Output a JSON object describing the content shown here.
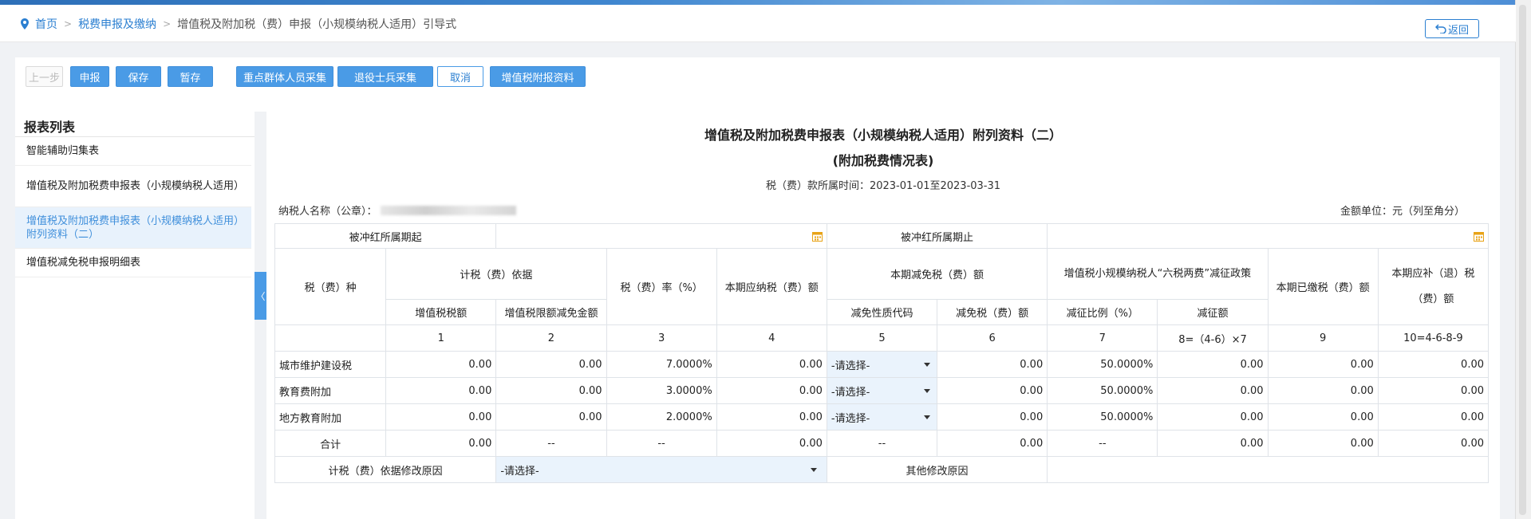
{
  "breadcrumb": {
    "home": "首页",
    "level1": "税费申报及缴纳",
    "current": "增值税及附加税（费）申报（小规模纳税人适用）引导式"
  },
  "back_label": "返回",
  "toolbar": {
    "prev": "上一步",
    "declare": "申报",
    "save": "保存",
    "temp_save": "暂存",
    "key_group": "重点群体人员采集",
    "veteran": "退役士兵采集",
    "cancel": "取消",
    "vat_attach": "增值税附报资料"
  },
  "sidebar": {
    "title": "报表列表",
    "items": [
      {
        "label": "智能辅助归集表"
      },
      {
        "label": "增值税及附加税费申报表（小规模纳税人适用）"
      },
      {
        "label": "增值税及附加税费申报表（小规模纳税人适用）附列资料（二）"
      },
      {
        "label": "增值税减免税申报明细表"
      }
    ],
    "collapse_glyph": "〈"
  },
  "form": {
    "title1": "增值税及附加税费申报表（小规模纳税人适用）附列资料（二）",
    "title2": "(附加税费情况表)",
    "period": "税（费）款所属时间：2023-01-01至2023-03-31",
    "taxpayer_label": "纳税人名称（公章）：",
    "unit": "金额单位：元（列至角分）",
    "offset_start_label": "被冲红所属期起",
    "offset_end_label": "被冲红所属期止",
    "headers": {
      "tax_type": "税（费）种",
      "basis": "计税（费）依据",
      "rate": "税（费）率（%）",
      "payable": "本期应纳税（费）额",
      "relief": "本期减免税（费）额",
      "six_tax": "增值税小规模纳税人“六税两费”减征政策",
      "paid": "本期已缴税（费）额",
      "refund": "本期应补（退）税（费）额",
      "vat_amount": "增值税税额",
      "vat_limit": "增值税限额减免金额",
      "relief_code": "减免性质代码",
      "relief_amount": "减免税（费）额",
      "reduce_ratio": "减征比例（%）",
      "reduce_amount": "减征额"
    },
    "col_numbers": [
      "1",
      "2",
      "3",
      "4",
      "5",
      "6",
      "7",
      "8=（4-6）×7",
      "9",
      "10=4-6-8-9"
    ],
    "rows": [
      {
        "name": "城市维护建设税",
        "c1": "0.00",
        "c2": "0.00",
        "c3": "7.0000%",
        "c4": "0.00",
        "c5": "-请选择-",
        "c6": "0.00",
        "c7": "50.0000%",
        "c8": "0.00",
        "c9": "0.00",
        "c10": "0.00"
      },
      {
        "name": "教育费附加",
        "c1": "0.00",
        "c2": "0.00",
        "c3": "3.0000%",
        "c4": "0.00",
        "c5": "-请选择-",
        "c6": "0.00",
        "c7": "50.0000%",
        "c8": "0.00",
        "c9": "0.00",
        "c10": "0.00"
      },
      {
        "name": "地方教育附加",
        "c1": "0.00",
        "c2": "0.00",
        "c3": "2.0000%",
        "c4": "0.00",
        "c5": "-请选择-",
        "c6": "0.00",
        "c7": "50.0000%",
        "c8": "0.00",
        "c9": "0.00",
        "c10": "0.00"
      }
    ],
    "total": {
      "name": "合计",
      "c1": "0.00",
      "c2": "--",
      "c3": "--",
      "c4": "0.00",
      "c5": "--",
      "c6": "0.00",
      "c7": "--",
      "c8": "0.00",
      "c9": "0.00",
      "c10": "0.00"
    },
    "modify_reason_label": "计税（费）依据修改原因",
    "modify_reason_placeholder": "-请选择-",
    "other_reason_label": "其他修改原因"
  }
}
